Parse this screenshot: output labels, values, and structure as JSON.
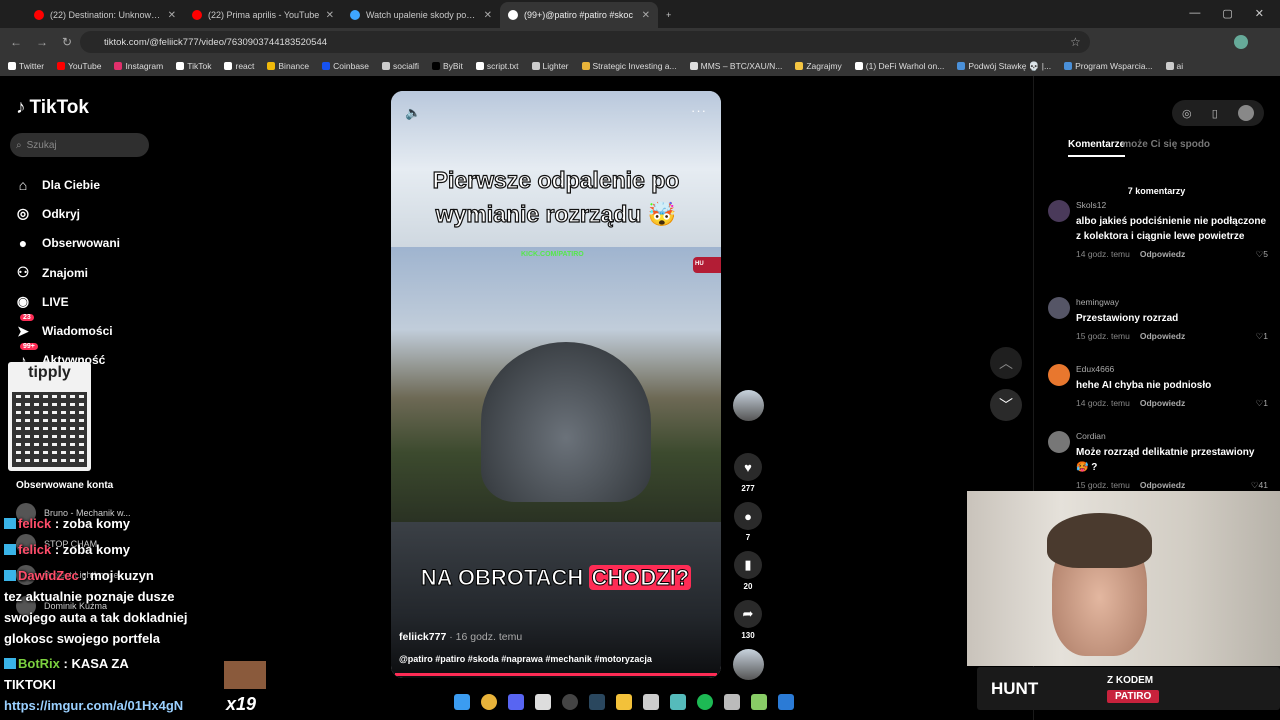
{
  "browser": {
    "tabs": [
      {
        "label": "(22) Destination: Unknown? - Yo",
        "color": "#ff0000",
        "active": false
      },
      {
        "label": "(22) Prima aprilis - YouTube",
        "color": "#ff0000",
        "active": false
      },
      {
        "label": "Watch upalenie skody po wym",
        "color": "#3ea6ff",
        "active": false
      },
      {
        "label": "(99+)@patiro #patiro #skoc",
        "color": "#ffffff",
        "active": true
      }
    ],
    "url": "tiktok.com/@feliick777/video/7630903744183520544",
    "bookmarks": [
      "Twitter",
      "YouTube",
      "Instagram",
      "TikTok",
      "react",
      "Binance",
      "Coinbase",
      "socialfi",
      "ByBit",
      "script.txt",
      "Lighter",
      "Strategic Investing a...",
      "MMS – BTC/XAU/N...",
      "Zagrajmy",
      "(1) DeFi Warhol on...",
      "Podwój Stawkę 💀 |...",
      "Program Wsparcia...",
      "ai"
    ]
  },
  "tiktok": {
    "logo": "TikTok",
    "search_placeholder": "Szukaj",
    "nav": [
      {
        "label": "Dla Ciebie",
        "icon": "home-icon",
        "badge": ""
      },
      {
        "label": "Odkryj",
        "icon": "compass-icon",
        "badge": ""
      },
      {
        "label": "Obserwowani",
        "icon": "avatar-icon",
        "badge": ""
      },
      {
        "label": "Znajomi",
        "icon": "friends-icon",
        "badge": ""
      },
      {
        "label": "LIVE",
        "icon": "live-icon",
        "badge": ""
      },
      {
        "label": "Wiadomości",
        "icon": "send-icon",
        "badge": "23"
      },
      {
        "label": "Aktywność",
        "icon": "bell-icon",
        "badge": "99+"
      }
    ],
    "followed_title": "Obserwowane konta",
    "followed": [
      "Bruno - Mechanik w...",
      "STOP CHAM",
      "Project Lighthouse",
      "Dominik Kuźma"
    ]
  },
  "overlay": {
    "tipply": "tipply",
    "chat": [
      {
        "user": "felick",
        "msg": " : zoba komy",
        "color": "red"
      },
      {
        "user": "felick",
        "msg": " : zoba komy",
        "color": "red"
      },
      {
        "user": "DawidZec",
        "msg": " : moj kuzyn",
        "color": "red"
      },
      {
        "user": "",
        "msg": "tez aktualnie poznaje dusze",
        "color": ""
      },
      {
        "user": "",
        "msg": "swojego auta a tak dokladniej",
        "color": ""
      },
      {
        "user": "",
        "msg": "glokosc swojego portfela",
        "color": ""
      },
      {
        "user": "BotRix",
        "msg": " : KASA ZA",
        "color": "green"
      },
      {
        "user": "",
        "msg": "TIKTOKI",
        "color": ""
      }
    ],
    "imgur": "https://imgur.com/a/01Hx4gN",
    "multiplier": "x19",
    "hunt_logo": "HUNT",
    "hunt_sub": "Z KODEM",
    "hunt_code": "PATIRO"
  },
  "video": {
    "caption_top": "Pierwsze odpalenie po wymianie rozrządu 🤯",
    "kick": "KICK.COM/PATIRO",
    "hunt_tag": "HU",
    "caption_bottom_a": "NA OBROTACH",
    "caption_bottom_b": "CHODZI?",
    "author": "feliick777",
    "time": " · 16 godz. temu",
    "tags": "@patiro #patiro #skoda #naprawa #mechanik #motoryzacja",
    "progress": 1.0,
    "likes": "277",
    "comments": "7",
    "saves": "20",
    "shares": "130"
  },
  "comments_panel": {
    "tab_comments": "Komentarze",
    "tab_suggest": "może Ci się spodo",
    "count": "7 komentarzy",
    "reply_label": "Odpowiedz",
    "items": [
      {
        "user": "Skols12",
        "text": "albo jakieś podciśnienie nie podłączone z kolektora i ciągnie lewe powietrze",
        "time": "14 godz. temu",
        "likes": "5"
      },
      {
        "user": "hemingway",
        "text": "Przestawiony rozrzad",
        "time": "15 godz. temu",
        "likes": "1"
      },
      {
        "user": "Edux4666",
        "text": "hehe AI chyba nie podniosło",
        "time": "14 godz. temu",
        "likes": "1"
      },
      {
        "user": "Cordian",
        "text": "Może rozrząd delikatnie przestawiony 🥵 ?",
        "time": "15 godz. temu",
        "likes": "41"
      }
    ]
  }
}
